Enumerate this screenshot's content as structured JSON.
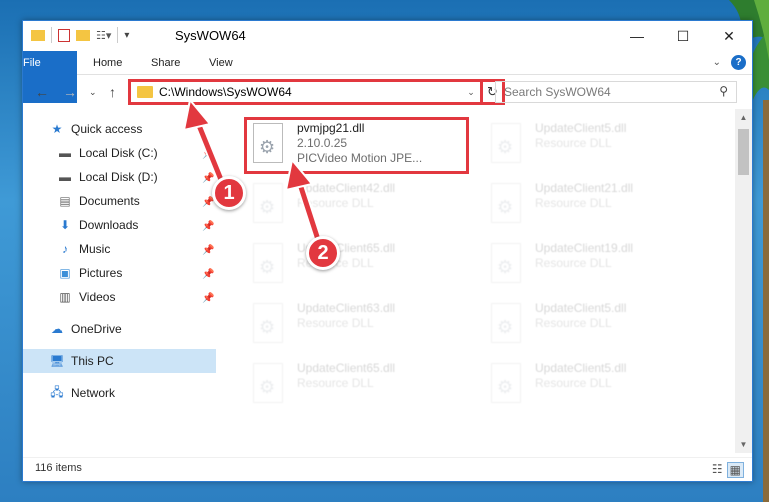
{
  "window": {
    "title": "SysWOW64",
    "ribbon_tabs": [
      "File",
      "Home",
      "Share",
      "View"
    ],
    "help_label": "?"
  },
  "address": {
    "path": "C:\\Windows\\SysWOW64",
    "search_placeholder": "Search SysWOW64"
  },
  "nav": {
    "items": [
      {
        "label": "Quick access",
        "icon": "star-icon"
      },
      {
        "label": "Local Disk (C:)",
        "icon": "drive-icon",
        "pinned": true
      },
      {
        "label": "Local Disk (D:)",
        "icon": "drive-icon",
        "pinned": true
      },
      {
        "label": "Documents",
        "icon": "documents-icon",
        "pinned": true
      },
      {
        "label": "Downloads",
        "icon": "downloads-icon",
        "pinned": true
      },
      {
        "label": "Music",
        "icon": "music-icon",
        "pinned": true
      },
      {
        "label": "Pictures",
        "icon": "pictures-icon",
        "pinned": true
      },
      {
        "label": "Videos",
        "icon": "videos-icon",
        "pinned": true
      },
      {
        "label": "OneDrive",
        "icon": "onedrive-icon"
      },
      {
        "label": "This PC",
        "icon": "pc-icon",
        "selected": true
      },
      {
        "label": "Network",
        "icon": "network-icon"
      }
    ]
  },
  "files": {
    "highlighted": {
      "name": "pvmjpg21.dll",
      "version": "2.10.0.25",
      "description": "PICVideo Motion JPE..."
    },
    "left_column": [
      {
        "name": "UpdateClient42.dll",
        "type": "Resource DLL"
      },
      {
        "name": "UpdateClient65.dll",
        "type": "Resource DLL"
      },
      {
        "name": "UpdateClient63.dll",
        "type": "Resource DLL"
      },
      {
        "name": "UpdateClient65.dll",
        "type": "Resource DLL"
      }
    ],
    "right_column": [
      {
        "name": "UpdateClient5.dll",
        "type": "Resource DLL"
      },
      {
        "name": "UpdateClient21.dll",
        "type": "Resource DLL"
      },
      {
        "name": "UpdateClient19.dll",
        "type": "Resource DLL"
      },
      {
        "name": "UpdateClient5.dll",
        "type": "Resource DLL"
      },
      {
        "name": "UpdateClient5.dll",
        "type": "Resource DLL"
      }
    ]
  },
  "status": {
    "item_count": "116 items"
  },
  "callouts": [
    "1",
    "2"
  ],
  "colors": {
    "accent": "#1a6ec8",
    "highlight": "#e2383f",
    "selected": "#cce4f7"
  }
}
